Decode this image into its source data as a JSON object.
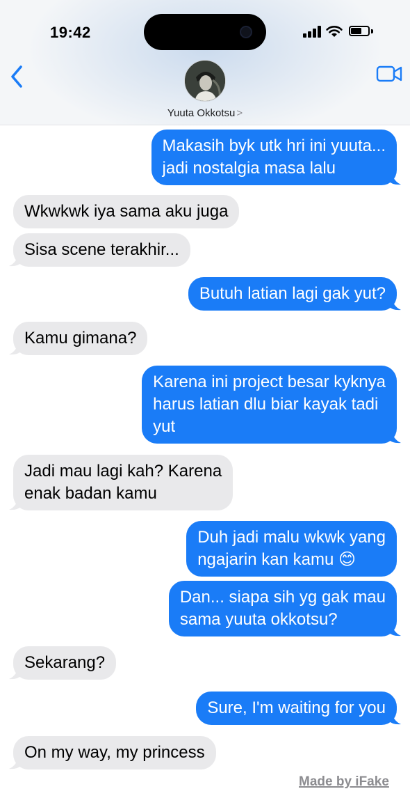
{
  "status_bar": {
    "time": "19:42"
  },
  "header": {
    "contact_name": "Yuuta Okkotsu",
    "chevron": ">"
  },
  "icons": [
    "back-chevron-icon",
    "video-camera-icon",
    "signal-icon",
    "wifi-icon",
    "battery-icon"
  ],
  "colors": {
    "sent_bubble": "#1a7cf7",
    "received_bubble": "#e9e9eb",
    "accent": "#1a7cf7"
  },
  "messages": [
    {
      "from": "me",
      "lines": [
        "Makasih byk utk hri ini yuuta...",
        "jadi nostalgia masa lalu"
      ]
    },
    {
      "from": "them",
      "lines": [
        "Wkwkwk iya sama aku juga"
      ]
    },
    {
      "from": "them",
      "lines": [
        "Sisa scene terakhir..."
      ]
    },
    {
      "from": "me",
      "lines": [
        "Butuh latian lagi gak yut?"
      ]
    },
    {
      "from": "them",
      "lines": [
        "Kamu gimana?"
      ]
    },
    {
      "from": "me",
      "lines": [
        "Karena ini project besar kyknya",
        "harus latian dlu biar kayak tadi",
        "yut"
      ]
    },
    {
      "from": "them",
      "lines": [
        "Jadi mau lagi kah? Karena",
        "enak badan kamu"
      ]
    },
    {
      "from": "me",
      "lines": [
        "Duh jadi malu wkwk yang",
        "ngajarin kan kamu 😊"
      ]
    },
    {
      "from": "me",
      "lines": [
        "Dan... siapa sih yg gak mau",
        "sama yuuta okkotsu?"
      ]
    },
    {
      "from": "them",
      "lines": [
        "Sekarang?"
      ]
    },
    {
      "from": "me",
      "lines": [
        "Sure, I'm waiting for you"
      ]
    },
    {
      "from": "them",
      "lines": [
        "On my way, my princess"
      ]
    }
  ],
  "footer": {
    "brand": "Made by iFake"
  }
}
